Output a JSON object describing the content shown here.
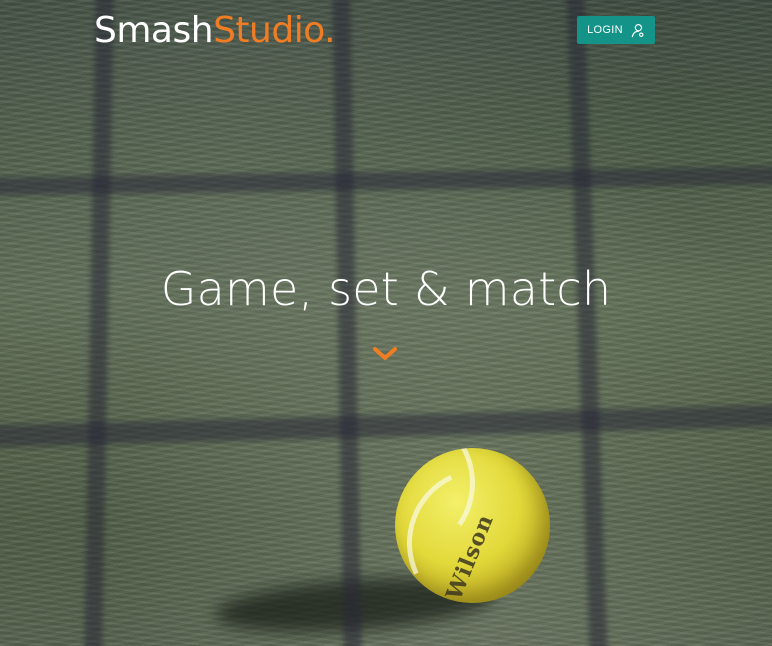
{
  "brand": {
    "name_part1": "Smash",
    "name_part2": "Studio."
  },
  "header": {
    "login_label": "LOGIN",
    "login_icon": "user-icon"
  },
  "hero": {
    "headline": "Game, set & match",
    "scroll_icon": "chevron-down-icon",
    "background": "tennis-ball-behind-net-photo",
    "ball_logo_text": "Wilson"
  },
  "colors": {
    "accent": "#f07d23",
    "login_button": "#149488",
    "text": "#ffffff"
  }
}
